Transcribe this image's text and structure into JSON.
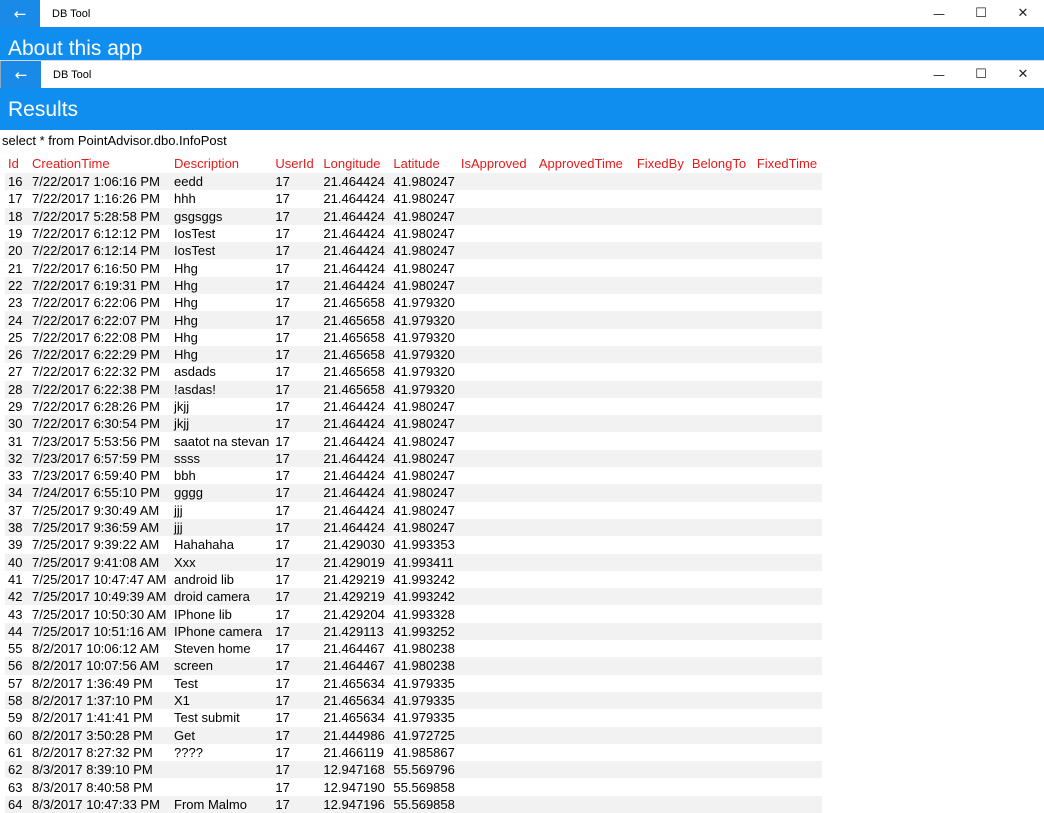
{
  "back_window": {
    "title": "DB Tool",
    "header": "About this app"
  },
  "front_window": {
    "title": "DB Tool",
    "header": "Results",
    "query": "select * from  PointAdvisor.dbo.InfoPost"
  },
  "icons": {
    "back": "arrow-left-icon",
    "minimize": "minimize-icon",
    "maximize": "maximize-icon",
    "close": "close-icon"
  },
  "colors": {
    "accent": "#0f8ef0",
    "column_header": "#e31b1b",
    "stripe": "#f2f2f2"
  },
  "table": {
    "columns": [
      "Id",
      "CreationTime",
      "Description",
      "UserId",
      "Longitude",
      "Latitude",
      "IsApproved",
      "ApprovedTime",
      "FixedBy",
      "BelongTo",
      "FixedTime"
    ],
    "rows": [
      [
        "16",
        "7/22/2017 1:06:16 PM",
        "eedd",
        "17",
        "21.464424",
        "41.980247"
      ],
      [
        "17",
        "7/22/2017 1:16:26 PM",
        "hhh",
        "17",
        "21.464424",
        "41.980247"
      ],
      [
        "18",
        "7/22/2017 5:28:58 PM",
        "gsgsggs",
        "17",
        "21.464424",
        "41.980247"
      ],
      [
        "19",
        "7/22/2017 6:12:12 PM",
        "IosTest",
        "17",
        "21.464424",
        "41.980247"
      ],
      [
        "20",
        "7/22/2017 6:12:14 PM",
        "IosTest",
        "17",
        "21.464424",
        "41.980247"
      ],
      [
        "21",
        "7/22/2017 6:16:50 PM",
        "Hhg",
        "17",
        "21.464424",
        "41.980247"
      ],
      [
        "22",
        "7/22/2017 6:19:31 PM",
        "Hhg",
        "17",
        "21.464424",
        "41.980247"
      ],
      [
        "23",
        "7/22/2017 6:22:06 PM",
        "Hhg",
        "17",
        "21.465658",
        "41.979320"
      ],
      [
        "24",
        "7/22/2017 6:22:07 PM",
        "Hhg",
        "17",
        "21.465658",
        "41.979320"
      ],
      [
        "25",
        "7/22/2017 6:22:08 PM",
        "Hhg",
        "17",
        "21.465658",
        "41.979320"
      ],
      [
        "26",
        "7/22/2017 6:22:29 PM",
        "Hhg",
        "17",
        "21.465658",
        "41.979320"
      ],
      [
        "27",
        "7/22/2017 6:22:32 PM",
        "asdads",
        "17",
        "21.465658",
        "41.979320"
      ],
      [
        "28",
        "7/22/2017 6:22:38 PM",
        "!asdas!",
        "17",
        "21.465658",
        "41.979320"
      ],
      [
        "29",
        "7/22/2017 6:28:26 PM",
        "jkjj",
        "17",
        "21.464424",
        "41.980247"
      ],
      [
        "30",
        "7/22/2017 6:30:54 PM",
        "jkjj",
        "17",
        "21.464424",
        "41.980247"
      ],
      [
        "31",
        "7/23/2017 5:53:56 PM",
        "saatot na stevan",
        "17",
        "21.464424",
        "41.980247"
      ],
      [
        "32",
        "7/23/2017 6:57:59 PM",
        "ssss",
        "17",
        "21.464424",
        "41.980247"
      ],
      [
        "33",
        "7/23/2017 6:59:40 PM",
        "bbh",
        "17",
        "21.464424",
        "41.980247"
      ],
      [
        "34",
        "7/24/2017 6:55:10 PM",
        "gggg",
        "17",
        "21.464424",
        "41.980247"
      ],
      [
        "37",
        "7/25/2017 9:30:49 AM",
        "jjj",
        "17",
        "21.464424",
        "41.980247"
      ],
      [
        "38",
        "7/25/2017 9:36:59 AM",
        "jjj",
        "17",
        "21.464424",
        "41.980247"
      ],
      [
        "39",
        "7/25/2017 9:39:22 AM",
        "Hahahaha",
        "17",
        "21.429030",
        "41.993353"
      ],
      [
        "40",
        "7/25/2017 9:41:08 AM",
        "Xxx",
        "17",
        "21.429019",
        "41.993411"
      ],
      [
        "41",
        "7/25/2017 10:47:47 AM",
        "android lib",
        "17",
        "21.429219",
        "41.993242"
      ],
      [
        "42",
        "7/25/2017 10:49:39 AM",
        "droid camera",
        "17",
        "21.429219",
        "41.993242"
      ],
      [
        "43",
        "7/25/2017 10:50:30 AM",
        "IPhone lib",
        "17",
        "21.429204",
        "41.993328"
      ],
      [
        "44",
        "7/25/2017 10:51:16 AM",
        "IPhone camera",
        "17",
        "21.429113",
        "41.993252"
      ],
      [
        "55",
        "8/2/2017 10:06:12 AM",
        "Steven home",
        "17",
        "21.464467",
        "41.980238"
      ],
      [
        "56",
        "8/2/2017 10:07:56 AM",
        "screen",
        "17",
        "21.464467",
        "41.980238"
      ],
      [
        "57",
        "8/2/2017 1:36:49 PM",
        "Test",
        "17",
        "21.465634",
        "41.979335"
      ],
      [
        "58",
        "8/2/2017 1:37:10 PM",
        "X1",
        "17",
        "21.465634",
        "41.979335"
      ],
      [
        "59",
        "8/2/2017 1:41:41 PM",
        "Test submit",
        "17",
        "21.465634",
        "41.979335"
      ],
      [
        "60",
        "8/2/2017 3:50:28 PM",
        "Get",
        "17",
        "21.444986",
        "41.972725"
      ],
      [
        "61",
        "8/2/2017 8:27:32 PM",
        "????",
        "17",
        "21.466119",
        "41.985867"
      ],
      [
        "62",
        "8/3/2017 8:39:10 PM",
        "",
        "17",
        "12.947168",
        "55.569796"
      ],
      [
        "63",
        "8/3/2017 8:40:58 PM",
        "",
        "17",
        "12.947190",
        "55.569858"
      ],
      [
        "64",
        "8/3/2017 10:47:33 PM",
        "From Malmo",
        "17",
        "12.947196",
        "55.569858"
      ]
    ]
  }
}
